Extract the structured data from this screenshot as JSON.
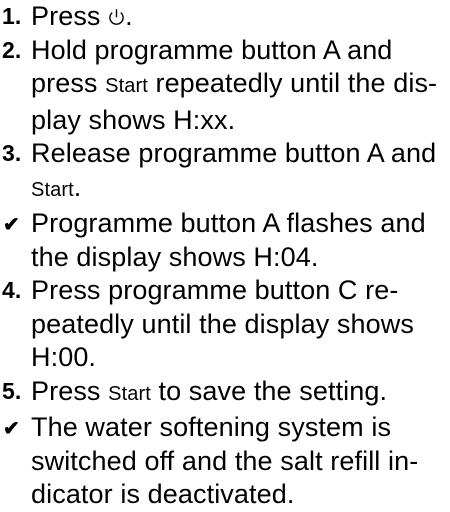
{
  "steps": [
    {
      "kind": "step",
      "marker": "1.",
      "text": "Press",
      "icon": "power-icon",
      "after_icon": "."
    },
    {
      "kind": "step",
      "marker": "2.",
      "before": "Hold programme button A and press ",
      "keyword": "Start",
      "after": " repeatedly until the dis-play shows H:xx."
    },
    {
      "kind": "step",
      "marker": "3.",
      "before": "Release programme button A and ",
      "keyword": "Start",
      "after": "."
    },
    {
      "kind": "result",
      "marker": "✔",
      "text": "Programme button A flashes and the display shows H:04."
    },
    {
      "kind": "step",
      "marker": "4.",
      "text": "Press programme button C re-peatedly until the display shows H:00."
    },
    {
      "kind": "step",
      "marker": "5.",
      "before": "Press ",
      "keyword": "Start",
      "after": " to save the setting."
    },
    {
      "kind": "result",
      "marker": "✔",
      "text": "The water softening system is switched off and the salt refill in-dicator is deactivated."
    }
  ]
}
